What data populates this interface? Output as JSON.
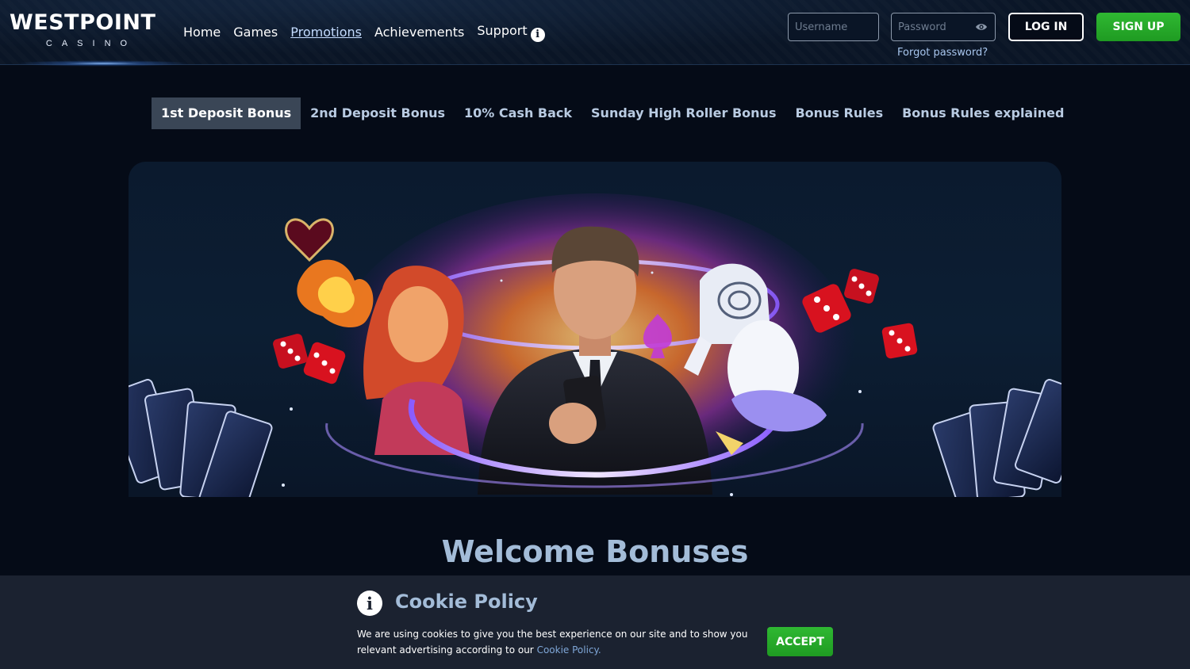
{
  "header": {
    "logo_title": "WESTPOINT",
    "logo_subtitle": "CASINO",
    "nav": [
      {
        "label": "Home",
        "active": false
      },
      {
        "label": "Games",
        "active": false
      },
      {
        "label": "Promotions",
        "active": true
      },
      {
        "label": "Achievements",
        "active": false
      },
      {
        "label": "Support",
        "active": false
      }
    ],
    "username_placeholder": "Username",
    "password_placeholder": "Password",
    "forgot_password": "Forgot password?",
    "login_label": "LOG IN",
    "signup_label": "SIGN UP"
  },
  "tabs": [
    {
      "label": "1st Deposit Bonus",
      "active": true
    },
    {
      "label": "2nd Deposit Bonus",
      "active": false
    },
    {
      "label": "10% Cash Back",
      "active": false
    },
    {
      "label": "Sunday High Roller Bonus",
      "active": false
    },
    {
      "label": "Bonus Rules",
      "active": false
    },
    {
      "label": "Bonus Rules explained",
      "active": false
    }
  ],
  "main": {
    "section_title": "Welcome Bonuses"
  },
  "cookie": {
    "title": "Cookie Policy",
    "text": "We are using cookies to give you the best experience on our site and to show you relevant advertising according to our",
    "link": "Cookie Policy.",
    "accept_label": "ACCEPT"
  },
  "colors": {
    "background": "#050b17",
    "header": "#0a1526",
    "accent_green": "#2fb832",
    "active_tab": "#3a4656",
    "title_blue": "#a3bcd8",
    "cookie_bar": "#1b2230"
  },
  "icons": {
    "support": "info-icon",
    "password_toggle": "eye-icon",
    "cookie": "info-icon"
  }
}
